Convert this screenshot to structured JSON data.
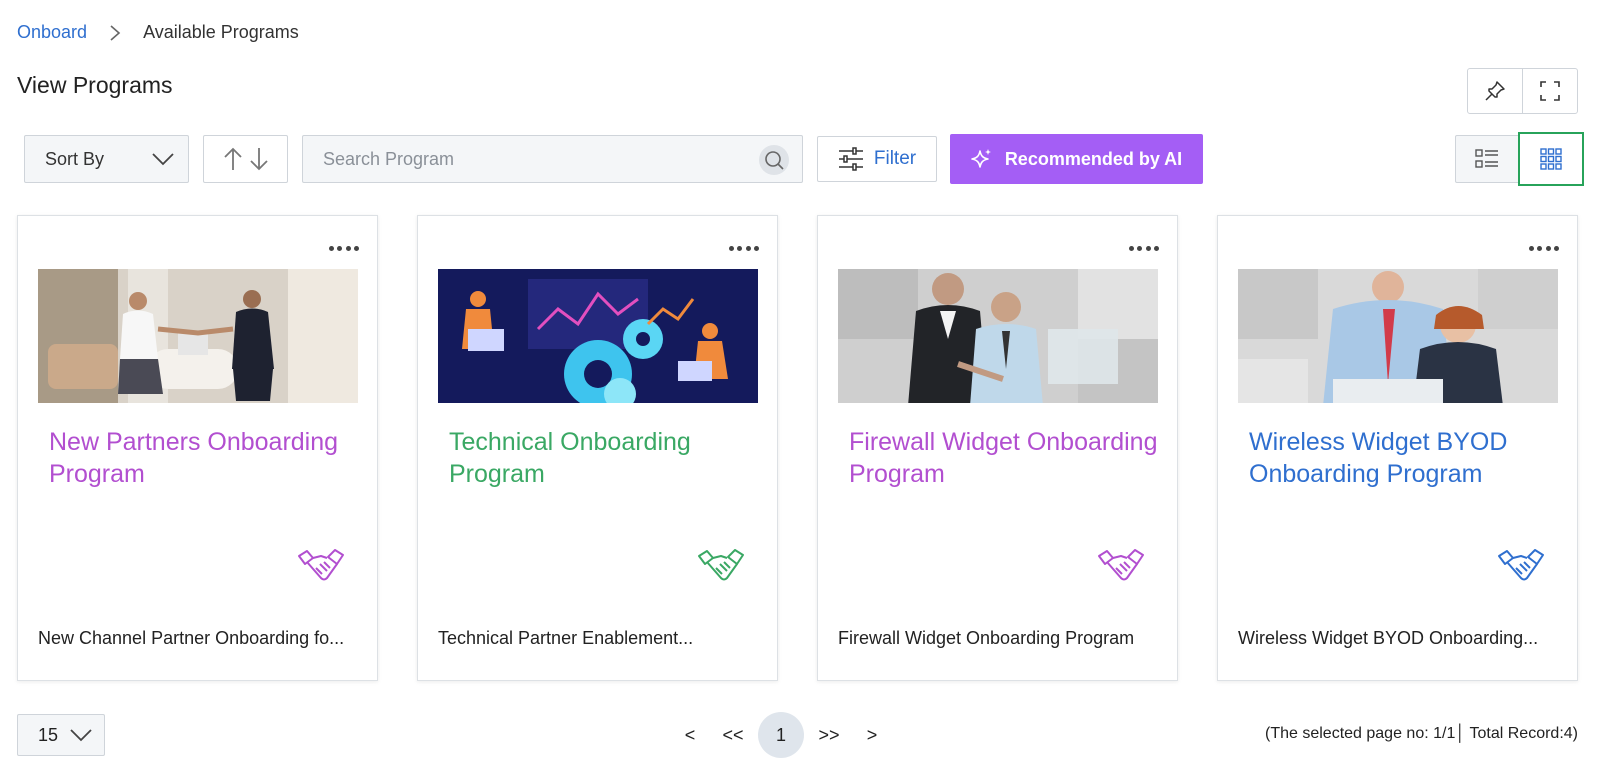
{
  "breadcrumb": {
    "root": "Onboard",
    "current": "Available Programs"
  },
  "page": {
    "title": "View Programs"
  },
  "toolbar": {
    "sort_label": "Sort By",
    "search_placeholder": "Search Program",
    "filter_label": "Filter",
    "ai_label": "Recommended by AI",
    "active_view": "grid"
  },
  "colors": {
    "accent": "#2f6fcf",
    "ai": "#a45ef5",
    "active_view_border": "#27a35a"
  },
  "programs": [
    {
      "title": "New Partners Onboarding Program",
      "description": "New Channel Partner Onboarding fo...",
      "color": "#b24fd0",
      "icon": "handshake-icon"
    },
    {
      "title": "Technical Onboarding Program",
      "description": "Technical Partner Enablement...",
      "color": "#3aa864",
      "icon": "handshake-icon"
    },
    {
      "title": "Firewall Widget Onboarding Program",
      "description": "Firewall Widget Onboarding Program",
      "color": "#b24fd0",
      "icon": "handshake-icon"
    },
    {
      "title": "Wireless Widget BYOD Onboarding Program",
      "description": "Wireless Widget BYOD Onboarding...",
      "color": "#2f6fcf",
      "icon": "handshake-icon"
    }
  ],
  "pagination": {
    "page_size": "15",
    "prev": "<",
    "first": "<<",
    "current": "1",
    "last": ">>",
    "next": ">",
    "info": "(The selected page no: 1/1│ Total Record:4)"
  }
}
